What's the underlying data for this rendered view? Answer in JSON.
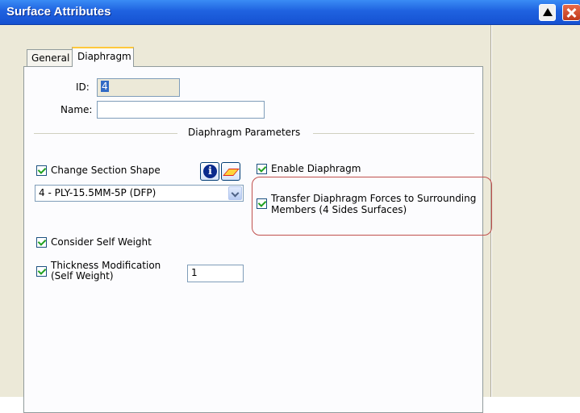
{
  "window": {
    "title": "Surface Attributes"
  },
  "tabs": [
    {
      "label": "General"
    },
    {
      "label": "Diaphragm"
    }
  ],
  "form": {
    "id_label": "ID:",
    "id_value": "4",
    "name_label": "Name:",
    "name_value": "",
    "section_header": "Diaphragm Parameters"
  },
  "options": {
    "change_section_shape": {
      "label": "Change Section Shape",
      "checked": true
    },
    "section_select": {
      "value": "4 - PLY-15.5MM-5P (DFP)"
    },
    "enable_diaphragm": {
      "label": "Enable Diaphragm",
      "checked": true
    },
    "transfer_forces": {
      "label": "Transfer Diaphragm Forces to Surrounding Members (4 Sides Surfaces)",
      "checked": true
    },
    "consider_self_weight": {
      "label": "Consider Self Weight",
      "checked": true
    },
    "thickness_modification": {
      "label": "Thickness Modification (Self Weight)",
      "checked": true,
      "value": "1"
    }
  },
  "icons": {
    "info": "info-icon",
    "section_shape": "section-shape-icon"
  },
  "colors": {
    "titlebar": "#1f62e0",
    "highlight_border": "#c0504d",
    "dialog_bg": "#ece9d8"
  }
}
